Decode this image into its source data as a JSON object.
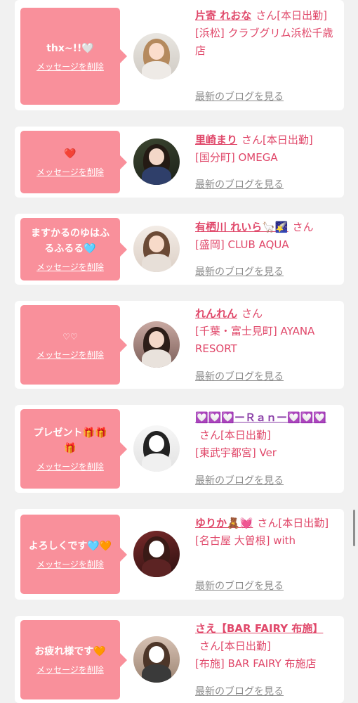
{
  "cards": [
    {
      "message": "thx~!!🤍",
      "delete_label": "メッセージを削除",
      "name": "片寄 れおな",
      "suffix": "さん[本日出勤]",
      "shop": "[浜松] クラブグリム浜松千歳店",
      "blog_label": "最新のブログを見る"
    },
    {
      "message": "❤️",
      "delete_label": "メッセージを削除",
      "name": "里崎まり",
      "suffix": "さん[本日出勤]",
      "shop": "[国分町] OMEGA",
      "blog_label": "最新のブログを見る"
    },
    {
      "message": "ますかるのゆはふるふるる🩵",
      "delete_label": "メッセージを削除",
      "name": "有栖川 れいら🦙🌠",
      "suffix": "さん",
      "shop": "[盛岡] CLUB AQUA",
      "blog_label": "最新のブログを見る"
    },
    {
      "message": "♡♡",
      "delete_label": "メッセージを削除",
      "name": "れんれん",
      "suffix": "さん",
      "shop": "[千葉・富士見町] AYANA RESORT",
      "blog_label": "最新のブログを見る"
    },
    {
      "message": "プレゼント🎁🎁🎁",
      "delete_label": "メッセージを削除",
      "name": "💟💟💟ーＲａｎー💟💟💟",
      "suffix": "さん[本日出勤]",
      "shop": "[東武宇都宮] Ver",
      "blog_label": "最新のブログを見る"
    },
    {
      "message": "よろしくです🩵🧡",
      "delete_label": "メッセージを削除",
      "name": "ゆりか🧸💓",
      "suffix": "さん[本日出勤]",
      "shop": "[名古屋 大曽根] with",
      "blog_label": "最新のブログを見る"
    },
    {
      "message": "お疲れ様です🧡",
      "delete_label": "メッセージを削除",
      "name": "さえ【BAR FAIRY 布施】",
      "suffix": "さん[本日出勤]",
      "shop": "[布施] BAR FAIRY 布施店",
      "blog_label": "最新のブログを見る"
    }
  ],
  "colors": {
    "bubble": "#f9909b",
    "name": "#e0486a",
    "blog_link": "#8b8b8b",
    "page_bg": "#f1f1f1"
  }
}
